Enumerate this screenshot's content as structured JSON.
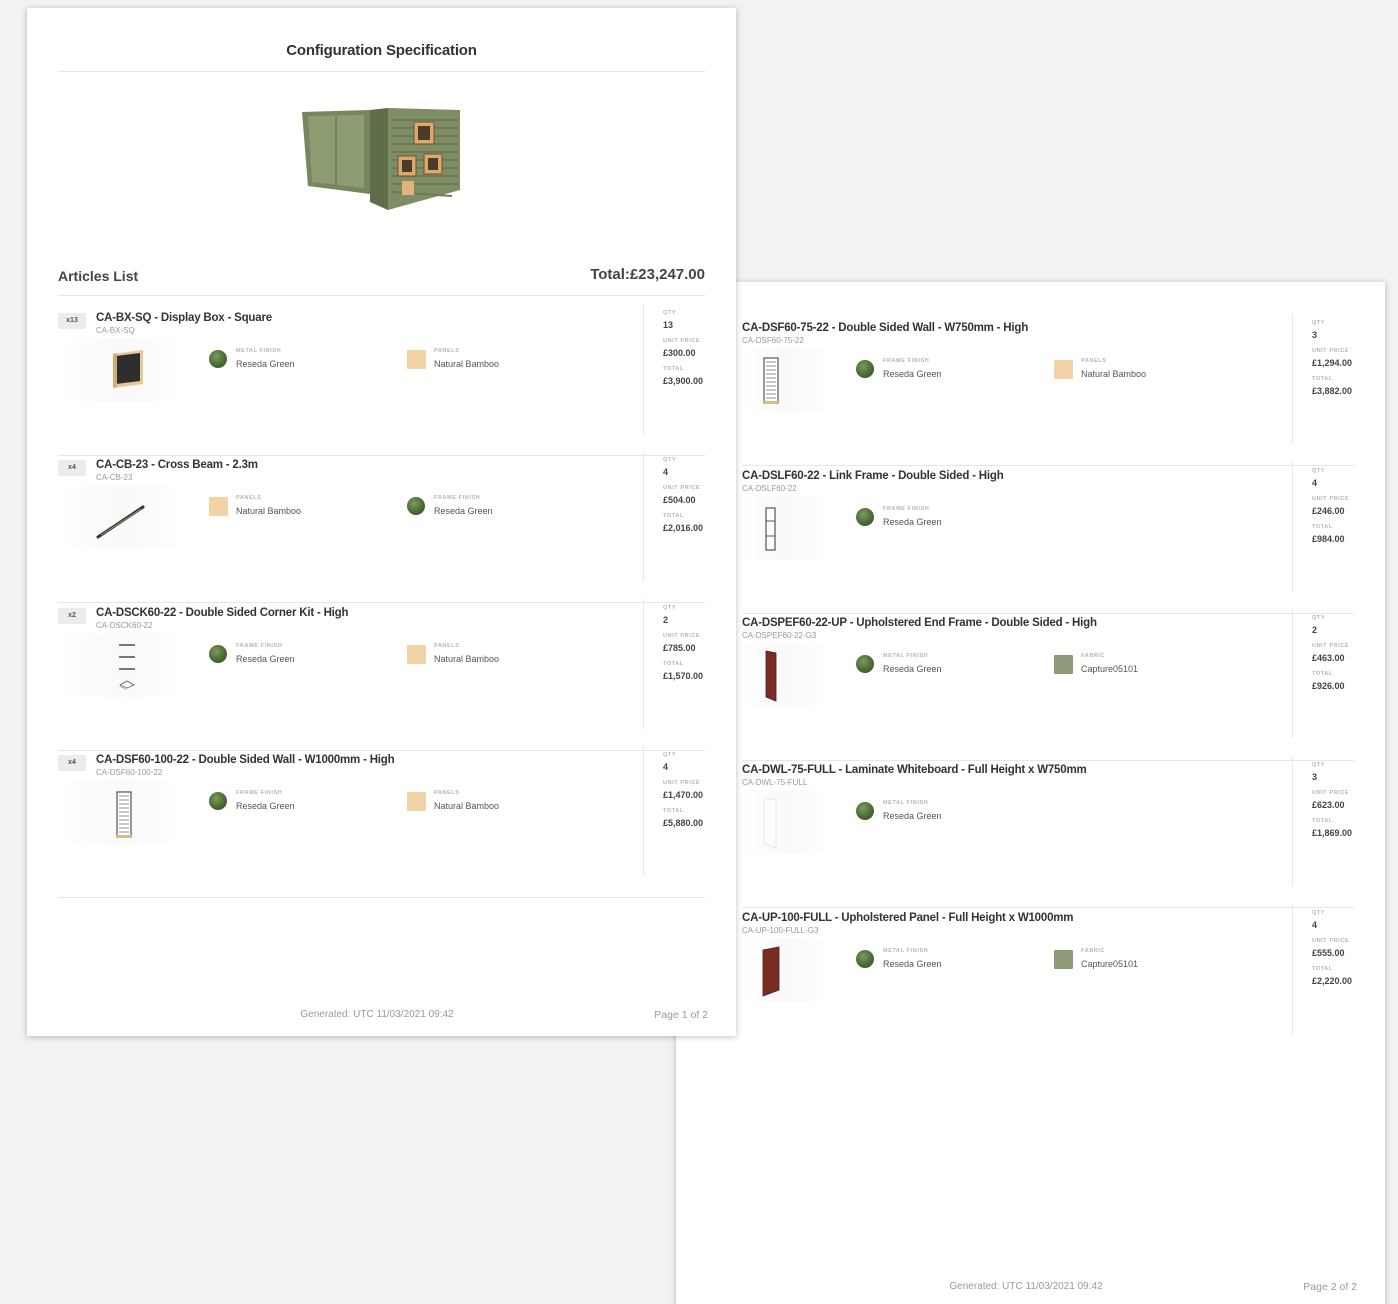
{
  "document": {
    "title": "Configuration Specification",
    "articles_title": "Articles List",
    "total_label": "Total:",
    "total_value": "£23,247.00",
    "labels": {
      "qty": "QTY",
      "unit_price": "UNIT PRICE",
      "total": "TOTAL"
    }
  },
  "page1": {
    "footer_generated": "Generated: UTC 11/03/2021 09:42",
    "footer_page": "Page 1 of 2",
    "articles": [
      {
        "badge": "x13",
        "name": "CA-BX-SQ - Display Box - Square",
        "code": "CA-BX-SQ",
        "thumb_icon": "display-box-icon",
        "attr1": {
          "label": "METAL FINISH",
          "value": "Reseda Green",
          "swatch_color": "#5b7a45"
        },
        "attr2": {
          "label": "PANELS",
          "value": "Natural Bamboo",
          "swatch_color": "#f2d3a6"
        },
        "qty": "13",
        "unit_price": "£300.00",
        "total": "£3,900.00"
      },
      {
        "badge": "x4",
        "name": "CA-CB-23 - Cross Beam - 2.3m",
        "code": "CA-CB-23",
        "thumb_icon": "cross-beam-icon",
        "attr1": {
          "label": "PANELS",
          "value": "Natural Bamboo",
          "swatch_color": "#f2d3a6"
        },
        "attr2": {
          "label": "FRAME FINISH",
          "value": "Reseda Green",
          "swatch_color": "#5b7a45"
        },
        "qty": "4",
        "unit_price": "£504.00",
        "total": "£2,016.00"
      },
      {
        "badge": "x2",
        "name": "CA-DSCK60-22 - Double Sided Corner Kit - High",
        "code": "CA-DSCK60-22",
        "thumb_icon": "corner-kit-icon",
        "attr1": {
          "label": "FRAME FINISH",
          "value": "Reseda Green",
          "swatch_color": "#5b7a45"
        },
        "attr2": {
          "label": "PANELS",
          "value": "Natural Bamboo",
          "swatch_color": "#f2d3a6"
        },
        "qty": "2",
        "unit_price": "£785.00",
        "total": "£1,570.00"
      },
      {
        "badge": "x4",
        "name": "CA-DSF60-100-22 - Double Sided Wall - W1000mm - High",
        "code": "CA-DSF60-100-22",
        "thumb_icon": "slatted-wall-icon",
        "attr1": {
          "label": "FRAME FINISH",
          "value": "Reseda Green",
          "swatch_color": "#5b7a45"
        },
        "attr2": {
          "label": "PANELS",
          "value": "Natural Bamboo",
          "swatch_color": "#f2d3a6"
        },
        "qty": "4",
        "unit_price": "£1,470.00",
        "total": "£5,880.00"
      }
    ]
  },
  "page2": {
    "footer_generated": "Generated: UTC 11/03/2021 09:42",
    "footer_page": "Page 2 of 2",
    "articles": [
      {
        "name": "CA-DSF60-75-22 - Double Sided Wall - W750mm - High",
        "code": "CA-DSF60-75-22",
        "thumb_icon": "slatted-wall-icon",
        "attr1": {
          "label": "FRAME FINISH",
          "value": "Reseda Green",
          "swatch_color": "#5b7a45"
        },
        "attr2": {
          "label": "PANELS",
          "value": "Natural Bamboo",
          "swatch_color": "#f2d3a6"
        },
        "qty": "3",
        "unit_price": "£1,294.00",
        "total": "£3,882.00"
      },
      {
        "name": "CA-DSLF60-22 - Link Frame - Double Sided - High",
        "code": "CA-DSLF60-22",
        "thumb_icon": "link-frame-icon",
        "attr1": {
          "label": "FRAME FINISH",
          "value": "Reseda Green",
          "swatch_color": "#5b7a45"
        },
        "qty": "4",
        "unit_price": "£246.00",
        "total": "£984.00"
      },
      {
        "name": "CA-DSPEF60-22-UP - Upholstered End Frame - Double Sided - High",
        "code": "CA-DSPEF60-22-G3",
        "thumb_icon": "upholstered-frame-icon",
        "attr1": {
          "label": "METAL FINISH",
          "value": "Reseda Green",
          "swatch_color": "#5b7a45"
        },
        "attr2": {
          "label": "FABRIC",
          "value": "Capture05101",
          "swatch_color": "#8e9a78"
        },
        "qty": "2",
        "unit_price": "£463.00",
        "total": "£926.00"
      },
      {
        "name": "CA-DWL-75-FULL - Laminate Whiteboard - Full Height x W750mm",
        "code": "CA-DWL-75-FULL",
        "thumb_icon": "whiteboard-icon",
        "attr1": {
          "label": "METAL FINISH",
          "value": "Reseda Green",
          "swatch_color": "#5b7a45"
        },
        "qty": "3",
        "unit_price": "£623.00",
        "total": "£1,869.00"
      },
      {
        "name": "CA-UP-100-FULL - Upholstered Panel - Full Height x W1000mm",
        "code": "CA-UP-100-FULL-G3",
        "thumb_icon": "upholstered-panel-icon",
        "attr1": {
          "label": "METAL FINISH",
          "value": "Reseda Green",
          "swatch_color": "#5b7a45"
        },
        "attr2": {
          "label": "FABRIC",
          "value": "Capture05101",
          "swatch_color": "#8e9a78"
        },
        "qty": "4",
        "unit_price": "£555.00",
        "total": "£2,220.00"
      }
    ]
  }
}
